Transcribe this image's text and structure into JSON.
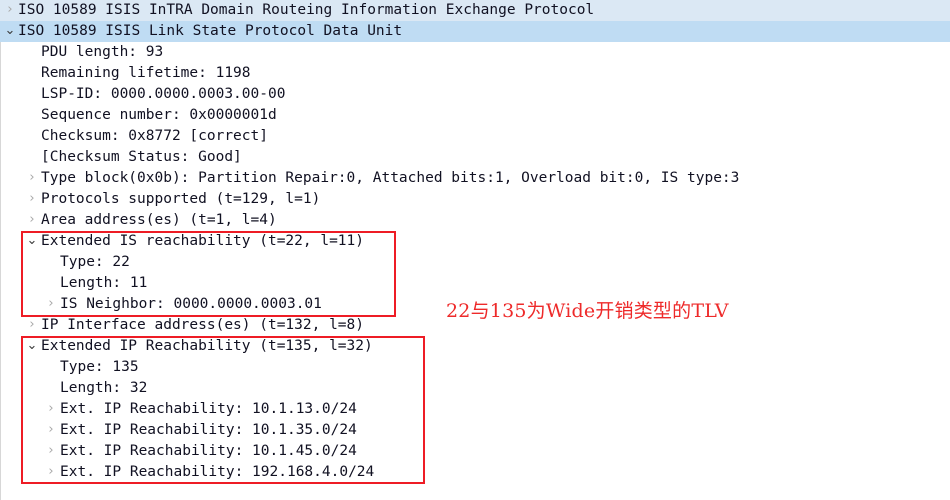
{
  "colors": {
    "selection_light": "#dbe8f4",
    "selection_strong": "#bfdcf3",
    "annotation_red": "#ee2a2a",
    "box_red": "#ee1c25",
    "text": "#111122",
    "chevron_gray": "#a8a8a8"
  },
  "tree": {
    "rows": [
      {
        "text": "ISO 10589 ISIS InTRA Domain Routeing Information Exchange Protocol",
        "indent": 0,
        "chevron": "collapsed",
        "chevron_tone": "gray",
        "selected": "light",
        "name": "tree-row-isis-intra-domain"
      },
      {
        "text": "ISO 10589 ISIS Link State Protocol Data Unit",
        "indent": 0,
        "chevron": "expanded",
        "chevron_tone": "dark",
        "selected": "strong",
        "name": "tree-row-isis-lsp"
      },
      {
        "text": "PDU length: 93",
        "indent": 1,
        "chevron": "none",
        "chevron_tone": "",
        "selected": "none",
        "name": "tree-row-pdu-length"
      },
      {
        "text": "Remaining lifetime: 1198",
        "indent": 1,
        "chevron": "none",
        "chevron_tone": "",
        "selected": "none",
        "name": "tree-row-remaining-lifetime"
      },
      {
        "text": "LSP-ID: 0000.0000.0003.00-00",
        "indent": 1,
        "chevron": "none",
        "chevron_tone": "",
        "selected": "none",
        "name": "tree-row-lsp-id"
      },
      {
        "text": "Sequence number: 0x0000001d",
        "indent": 1,
        "chevron": "none",
        "chevron_tone": "",
        "selected": "none",
        "name": "tree-row-sequence-number"
      },
      {
        "text": "Checksum: 0x8772 [correct]",
        "indent": 1,
        "chevron": "none",
        "chevron_tone": "",
        "selected": "none",
        "name": "tree-row-checksum"
      },
      {
        "text": "[Checksum Status: Good]",
        "indent": 1,
        "chevron": "none",
        "chevron_tone": "",
        "selected": "none",
        "name": "tree-row-checksum-status"
      },
      {
        "text": "Type block(0x0b): Partition Repair:0, Attached bits:1, Overload bit:0, IS type:3",
        "indent": 1,
        "chevron": "collapsed",
        "chevron_tone": "gray",
        "selected": "none",
        "name": "tree-row-type-block"
      },
      {
        "text": "Protocols supported (t=129, l=1)",
        "indent": 1,
        "chevron": "collapsed",
        "chevron_tone": "gray",
        "selected": "none",
        "name": "tree-row-protocols-supported"
      },
      {
        "text": "Area address(es) (t=1, l=4)",
        "indent": 1,
        "chevron": "collapsed",
        "chevron_tone": "gray",
        "selected": "none",
        "name": "tree-row-area-addresses"
      },
      {
        "text": "Extended IS reachability (t=22, l=11)",
        "indent": 1,
        "chevron": "expanded",
        "chevron_tone": "dark",
        "selected": "none",
        "name": "tree-row-extended-is-reachability"
      },
      {
        "text": "Type: 22",
        "indent": 2,
        "chevron": "none",
        "chevron_tone": "",
        "selected": "none",
        "name": "tree-row-is-reach-type"
      },
      {
        "text": "Length: 11",
        "indent": 2,
        "chevron": "none",
        "chevron_tone": "",
        "selected": "none",
        "name": "tree-row-is-reach-length"
      },
      {
        "text": "IS Neighbor: 0000.0000.0003.01",
        "indent": 2,
        "chevron": "collapsed",
        "chevron_tone": "gray",
        "selected": "none",
        "name": "tree-row-is-neighbor"
      },
      {
        "text": "IP Interface address(es) (t=132, l=8)",
        "indent": 1,
        "chevron": "collapsed",
        "chevron_tone": "gray",
        "selected": "none",
        "name": "tree-row-ip-interface-addresses"
      },
      {
        "text": "Extended IP Reachability (t=135, l=32)",
        "indent": 1,
        "chevron": "expanded",
        "chevron_tone": "dark",
        "selected": "none",
        "name": "tree-row-extended-ip-reachability"
      },
      {
        "text": "Type: 135",
        "indent": 2,
        "chevron": "none",
        "chevron_tone": "",
        "selected": "none",
        "name": "tree-row-ip-reach-type"
      },
      {
        "text": "Length: 32",
        "indent": 2,
        "chevron": "none",
        "chevron_tone": "",
        "selected": "none",
        "name": "tree-row-ip-reach-length"
      },
      {
        "text": "Ext. IP Reachability: 10.1.13.0/24",
        "indent": 2,
        "chevron": "collapsed",
        "chevron_tone": "gray",
        "selected": "none",
        "name": "tree-row-ext-ip-reach-1"
      },
      {
        "text": "Ext. IP Reachability: 10.1.35.0/24",
        "indent": 2,
        "chevron": "collapsed",
        "chevron_tone": "gray",
        "selected": "none",
        "name": "tree-row-ext-ip-reach-2"
      },
      {
        "text": "Ext. IP Reachability: 10.1.45.0/24",
        "indent": 2,
        "chevron": "collapsed",
        "chevron_tone": "gray",
        "selected": "none",
        "name": "tree-row-ext-ip-reach-3"
      },
      {
        "text": "Ext. IP Reachability: 192.168.4.0/24",
        "indent": 2,
        "chevron": "collapsed",
        "chevron_tone": "gray",
        "selected": "none",
        "name": "tree-row-ext-ip-reach-4"
      }
    ]
  },
  "annotations": {
    "wide_metric_note": "22与135为Wide开销类型的TLV"
  }
}
